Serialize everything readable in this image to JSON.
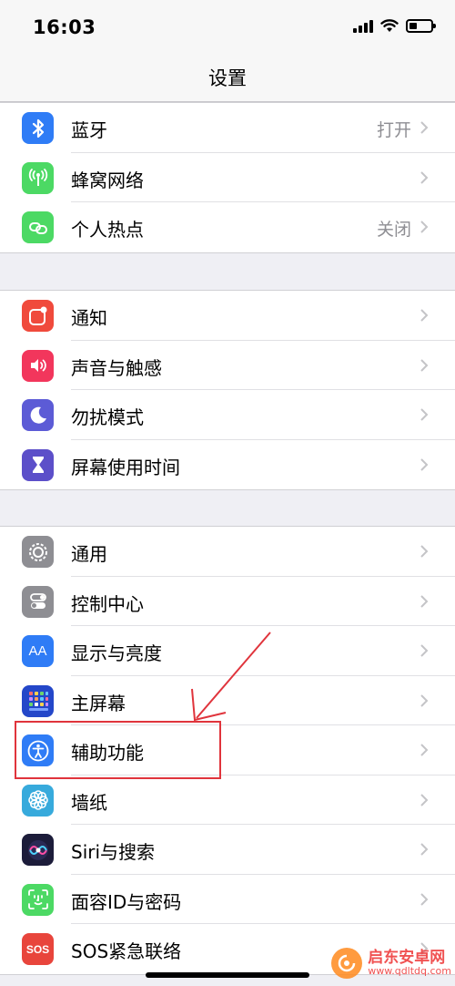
{
  "status_bar": {
    "time": "16:03"
  },
  "nav": {
    "title": "设置"
  },
  "groups": [
    {
      "items": [
        {
          "label": "蓝牙",
          "value": "打开",
          "icon": "bluetooth-icon",
          "color": "#2f7cf6"
        },
        {
          "label": "蜂窝网络",
          "value": "",
          "icon": "cellular-icon",
          "color": "#4cd964"
        },
        {
          "label": "个人热点",
          "value": "关闭",
          "icon": "hotspot-icon",
          "color": "#4cd964"
        }
      ]
    },
    {
      "items": [
        {
          "label": "通知",
          "value": "",
          "icon": "notifications-icon",
          "color": "#f04a3c"
        },
        {
          "label": "声音与触感",
          "value": "",
          "icon": "sounds-icon",
          "color": "#f2365c"
        },
        {
          "label": "勿扰模式",
          "value": "",
          "icon": "moon-icon",
          "color": "#5c5bd6"
        },
        {
          "label": "屏幕使用时间",
          "value": "",
          "icon": "hourglass-icon",
          "color": "#5c4fc9"
        }
      ]
    },
    {
      "items": [
        {
          "label": "通用",
          "value": "",
          "icon": "gear-icon",
          "color": "#8e8e93"
        },
        {
          "label": "控制中心",
          "value": "",
          "icon": "toggles-icon",
          "color": "#8e8e93"
        },
        {
          "label": "显示与亮度",
          "value": "",
          "icon": "text-size-icon",
          "color": "#2f7cf6"
        },
        {
          "label": "主屏幕",
          "value": "",
          "icon": "home-grid-icon",
          "color": "#2447c9"
        },
        {
          "label": "辅助功能",
          "value": "",
          "icon": "accessibility-icon",
          "color": "#2f7cf6"
        },
        {
          "label": "墙纸",
          "value": "",
          "icon": "flower-icon",
          "color": "#37aadc"
        },
        {
          "label": "Siri与搜索",
          "value": "",
          "icon": "siri-icon",
          "color": "#1c1c3a"
        },
        {
          "label": "面容ID与密码",
          "value": "",
          "icon": "faceid-icon",
          "color": "#4cd964"
        },
        {
          "label": "SOS紧急联络",
          "value": "",
          "icon": "sos-icon",
          "color": "#e8453c"
        }
      ]
    }
  ],
  "sos_icon_text": "SOS",
  "text_size_icon_text": "AA",
  "watermark": {
    "name": "启东安卓网",
    "url": "www.qdltdq.com"
  }
}
